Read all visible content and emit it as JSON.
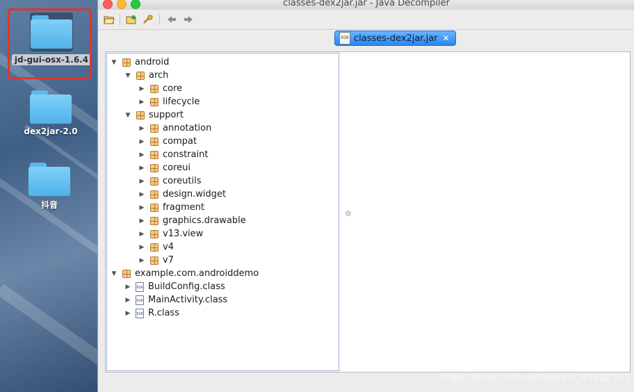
{
  "desktop": {
    "items": [
      {
        "label": "jd-gui-osx-1.6.4",
        "selected": true
      },
      {
        "label": "dex2jar-2.0",
        "selected": false
      },
      {
        "label": "抖音",
        "selected": false
      }
    ]
  },
  "window": {
    "title": "classes-dex2jar.jar - Java Decompiler",
    "toolbar": {
      "open_icon": "open-folder-icon",
      "open_type_icon": "open-type-icon",
      "search_icon": "search-icon",
      "back_icon": "back-arrow-icon",
      "forward_icon": "forward-arrow-icon"
    },
    "tab": {
      "label": "classes-dex2jar.jar",
      "icon": "jar-file-icon",
      "close": "✕"
    }
  },
  "tree": {
    "nodes": [
      {
        "label": "android",
        "type": "package",
        "expanded": true,
        "depth": 0
      },
      {
        "label": "arch",
        "type": "package",
        "expanded": true,
        "depth": 1
      },
      {
        "label": "core",
        "type": "package",
        "expanded": false,
        "depth": 2
      },
      {
        "label": "lifecycle",
        "type": "package",
        "expanded": false,
        "depth": 2
      },
      {
        "label": "support",
        "type": "package",
        "expanded": true,
        "depth": 1
      },
      {
        "label": "annotation",
        "type": "package",
        "expanded": false,
        "depth": 2
      },
      {
        "label": "compat",
        "type": "package",
        "expanded": false,
        "depth": 2
      },
      {
        "label": "constraint",
        "type": "package",
        "expanded": false,
        "depth": 2
      },
      {
        "label": "coreui",
        "type": "package",
        "expanded": false,
        "depth": 2
      },
      {
        "label": "coreutils",
        "type": "package",
        "expanded": false,
        "depth": 2
      },
      {
        "label": "design.widget",
        "type": "package",
        "expanded": false,
        "depth": 2
      },
      {
        "label": "fragment",
        "type": "package",
        "expanded": false,
        "depth": 2
      },
      {
        "label": "graphics.drawable",
        "type": "package",
        "expanded": false,
        "depth": 2
      },
      {
        "label": "v13.view",
        "type": "package",
        "expanded": false,
        "depth": 2
      },
      {
        "label": "v4",
        "type": "package",
        "expanded": false,
        "depth": 2
      },
      {
        "label": "v7",
        "type": "package",
        "expanded": false,
        "depth": 2
      },
      {
        "label": "example.com.androiddemo",
        "type": "package",
        "expanded": true,
        "depth": 0
      },
      {
        "label": "BuildConfig.class",
        "type": "class",
        "expanded": false,
        "depth": 1
      },
      {
        "label": "MainActivity.class",
        "type": "class",
        "expanded": false,
        "depth": 1
      },
      {
        "label": "R.class",
        "type": "class",
        "expanded": false,
        "depth": 1
      }
    ]
  },
  "watermark": "https://blog.csdn.net/weixin_43582101"
}
